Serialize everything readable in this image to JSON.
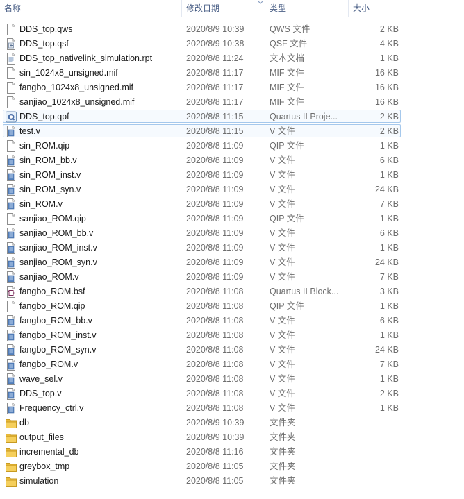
{
  "columns": {
    "name": "名称",
    "date": "修改日期",
    "type": "类型",
    "size": "大小"
  },
  "files": [
    {
      "name": "DDS_top.qws",
      "date": "2020/8/9 10:39",
      "type": "QWS 文件",
      "size": "2 KB",
      "icon": "doc"
    },
    {
      "name": "DDS_top.qsf",
      "date": "2020/8/9 10:38",
      "type": "QSF 文件",
      "size": "4 KB",
      "icon": "cfg"
    },
    {
      "name": "DDS_top_nativelink_simulation.rpt",
      "date": "2020/8/8 11:24",
      "type": "文本文档",
      "size": "1 KB",
      "icon": "text"
    },
    {
      "name": "sin_1024x8_unsigned.mif",
      "date": "2020/8/8 11:17",
      "type": "MIF 文件",
      "size": "16 KB",
      "icon": "doc"
    },
    {
      "name": "fangbo_1024x8_unsigned.mif",
      "date": "2020/8/8 11:17",
      "type": "MIF 文件",
      "size": "16 KB",
      "icon": "doc"
    },
    {
      "name": "sanjiao_1024x8_unsigned.mif",
      "date": "2020/8/8 11:17",
      "type": "MIF 文件",
      "size": "16 KB",
      "icon": "doc"
    },
    {
      "name": "DDS_top.qpf",
      "date": "2020/8/8 11:15",
      "type": "Quartus II Proje...",
      "size": "2 KB",
      "icon": "quartus",
      "hl": true
    },
    {
      "name": "test.v",
      "date": "2020/8/8 11:15",
      "type": "V 文件",
      "size": "2 KB",
      "icon": "vfile",
      "hl": true
    },
    {
      "name": "sin_ROM.qip",
      "date": "2020/8/8 11:09",
      "type": "QIP 文件",
      "size": "1 KB",
      "icon": "doc"
    },
    {
      "name": "sin_ROM_bb.v",
      "date": "2020/8/8 11:09",
      "type": "V 文件",
      "size": "6 KB",
      "icon": "vfile"
    },
    {
      "name": "sin_ROM_inst.v",
      "date": "2020/8/8 11:09",
      "type": "V 文件",
      "size": "1 KB",
      "icon": "vfile"
    },
    {
      "name": "sin_ROM_syn.v",
      "date": "2020/8/8 11:09",
      "type": "V 文件",
      "size": "24 KB",
      "icon": "vfile"
    },
    {
      "name": "sin_ROM.v",
      "date": "2020/8/8 11:09",
      "type": "V 文件",
      "size": "7 KB",
      "icon": "vfile"
    },
    {
      "name": "sanjiao_ROM.qip",
      "date": "2020/8/8 11:09",
      "type": "QIP 文件",
      "size": "1 KB",
      "icon": "doc"
    },
    {
      "name": "sanjiao_ROM_bb.v",
      "date": "2020/8/8 11:09",
      "type": "V 文件",
      "size": "6 KB",
      "icon": "vfile"
    },
    {
      "name": "sanjiao_ROM_inst.v",
      "date": "2020/8/8 11:09",
      "type": "V 文件",
      "size": "1 KB",
      "icon": "vfile"
    },
    {
      "name": "sanjiao_ROM_syn.v",
      "date": "2020/8/8 11:09",
      "type": "V 文件",
      "size": "24 KB",
      "icon": "vfile"
    },
    {
      "name": "sanjiao_ROM.v",
      "date": "2020/8/8 11:09",
      "type": "V 文件",
      "size": "7 KB",
      "icon": "vfile"
    },
    {
      "name": "fangbo_ROM.bsf",
      "date": "2020/8/8 11:08",
      "type": "Quartus II Block...",
      "size": "3 KB",
      "icon": "bsf"
    },
    {
      "name": "fangbo_ROM.qip",
      "date": "2020/8/8 11:08",
      "type": "QIP 文件",
      "size": "1 KB",
      "icon": "doc"
    },
    {
      "name": "fangbo_ROM_bb.v",
      "date": "2020/8/8 11:08",
      "type": "V 文件",
      "size": "6 KB",
      "icon": "vfile"
    },
    {
      "name": "fangbo_ROM_inst.v",
      "date": "2020/8/8 11:08",
      "type": "V 文件",
      "size": "1 KB",
      "icon": "vfile"
    },
    {
      "name": "fangbo_ROM_syn.v",
      "date": "2020/8/8 11:08",
      "type": "V 文件",
      "size": "24 KB",
      "icon": "vfile"
    },
    {
      "name": "fangbo_ROM.v",
      "date": "2020/8/8 11:08",
      "type": "V 文件",
      "size": "7 KB",
      "icon": "vfile"
    },
    {
      "name": "wave_sel.v",
      "date": "2020/8/8 11:08",
      "type": "V 文件",
      "size": "1 KB",
      "icon": "vfile"
    },
    {
      "name": "DDS_top.v",
      "date": "2020/8/8 11:08",
      "type": "V 文件",
      "size": "2 KB",
      "icon": "vfile"
    },
    {
      "name": "Frequency_ctrl.v",
      "date": "2020/8/8 11:08",
      "type": "V 文件",
      "size": "1 KB",
      "icon": "vfile"
    },
    {
      "name": "db",
      "date": "2020/8/9 10:39",
      "type": "文件夹",
      "size": "",
      "icon": "folder"
    },
    {
      "name": "output_files",
      "date": "2020/8/9 10:39",
      "type": "文件夹",
      "size": "",
      "icon": "folder"
    },
    {
      "name": "incremental_db",
      "date": "2020/8/8 11:16",
      "type": "文件夹",
      "size": "",
      "icon": "folder"
    },
    {
      "name": "greybox_tmp",
      "date": "2020/8/8 11:05",
      "type": "文件夹",
      "size": "",
      "icon": "folder"
    },
    {
      "name": "simulation",
      "date": "2020/8/8 11:05",
      "type": "文件夹",
      "size": "",
      "icon": "folder"
    }
  ]
}
